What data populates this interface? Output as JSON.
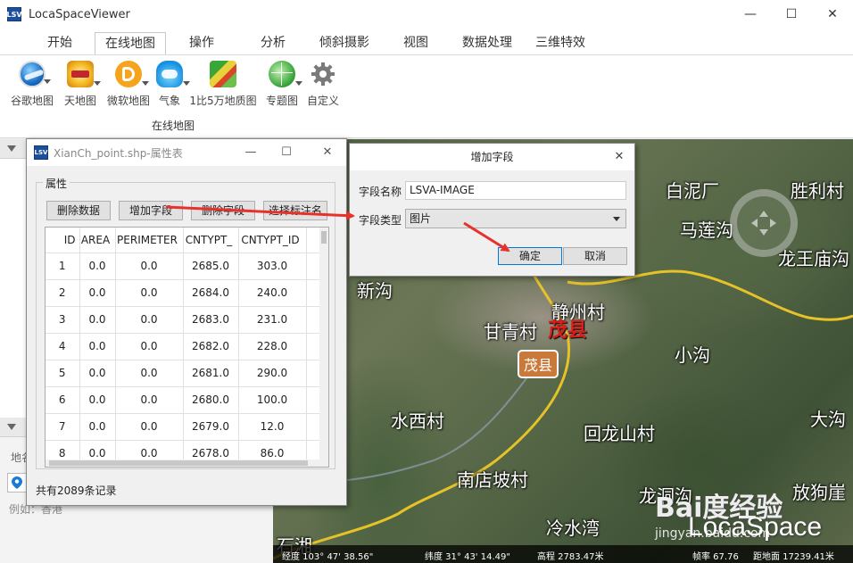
{
  "window": {
    "title": "LocaSpaceViewer",
    "icon_text": "LSV",
    "controls": {
      "minimize": "—",
      "maximize": "☐",
      "close": "✕"
    }
  },
  "ribbon": {
    "tabs": [
      "开始",
      "在线地图",
      "操作",
      "分析",
      "倾斜摄影",
      "视图",
      "数据处理",
      "三维特效"
    ],
    "active_tab": "在线地图",
    "buttons": [
      {
        "label": "谷歌地图",
        "icon": "google-earth-icon",
        "has_dropdown": true
      },
      {
        "label": "天地图",
        "icon": "tianditu-icon",
        "has_dropdown": true
      },
      {
        "label": "微软地图",
        "icon": "bing-icon",
        "has_dropdown": true
      },
      {
        "label": "气象",
        "icon": "weather-cloud-icon",
        "has_dropdown": true
      },
      {
        "label": "1比5万地质图",
        "icon": "geology-map-icon",
        "has_dropdown": false
      },
      {
        "label": "专题图",
        "icon": "globe-icon",
        "has_dropdown": true
      },
      {
        "label": "自定义",
        "icon": "gear-icon",
        "has_dropdown": false
      }
    ],
    "group_label": "在线地图"
  },
  "left_panel": {
    "search_label": "地名",
    "example_text": "例如：香港"
  },
  "attribute_window": {
    "title": "XianCh_point.shp-属性表",
    "icon_text": "LSV",
    "controls": {
      "minimize": "—",
      "maximize": "☐",
      "close": "✕"
    },
    "group_label": "属性",
    "buttons": [
      "删除数据",
      "增加字段",
      "删除字段",
      "选择标注名"
    ],
    "table": {
      "columns": [
        "ID",
        "AREA",
        "PERIMETER",
        "CNTYPT_",
        "CNTYPT_ID"
      ],
      "rows": [
        [
          "1",
          "0.0",
          "0.0",
          "2685.0",
          "303.0"
        ],
        [
          "2",
          "0.0",
          "0.0",
          "2684.0",
          "240.0"
        ],
        [
          "3",
          "0.0",
          "0.0",
          "2683.0",
          "231.0"
        ],
        [
          "4",
          "0.0",
          "0.0",
          "2682.0",
          "228.0"
        ],
        [
          "5",
          "0.0",
          "0.0",
          "2681.0",
          "290.0"
        ],
        [
          "6",
          "0.0",
          "0.0",
          "2680.0",
          "100.0"
        ],
        [
          "7",
          "0.0",
          "0.0",
          "2679.0",
          "12.0"
        ],
        [
          "8",
          "0.0",
          "0.0",
          "2678.0",
          "86.0"
        ]
      ]
    },
    "record_count": "共有2089条记录"
  },
  "add_field_dialog": {
    "title": "增加字段",
    "close": "✕",
    "name_label": "字段名称",
    "name_value": "LSVA-IMAGE",
    "type_label": "字段类型",
    "type_value": "图片",
    "ok_label": "确定",
    "cancel_label": "取消"
  },
  "map": {
    "labels": [
      "白泥厂",
      "胜利村",
      "马莲沟",
      "龙王庙沟",
      "新沟",
      "静州村",
      "甘青村",
      "小沟",
      "水西村",
      "回龙山村",
      "大沟",
      "南店坡村",
      "龙洞沟",
      "放狗崖",
      "冷水湾",
      "石湘"
    ],
    "county_name": "茂县",
    "county_badge": "茂县",
    "brand": "LocaSpace",
    "watermark": "Bai度经验",
    "watermark_url": "jingyan.baidu.com",
    "status": {
      "longitude": "经度 103° 47' 38.56\"",
      "latitude": "纬度 31° 43' 14.49\"",
      "altitude": "高程 2783.47米",
      "scale": "帧率 67.76",
      "distance": "距地面 17239.41米"
    },
    "colors": {
      "road": "#e6c229",
      "highlight_red": "#d8201a",
      "arrow_red": "#e8312a"
    }
  }
}
